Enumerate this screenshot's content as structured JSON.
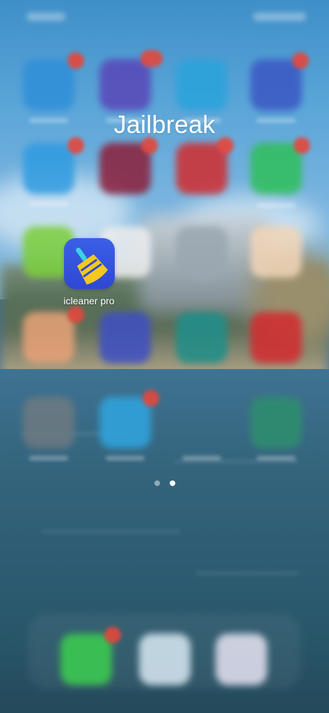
{
  "folder": {
    "title": "Jailbreak"
  },
  "app": {
    "label": "icleaner pro",
    "icon": "broom-icon",
    "icon_color": "#3553de",
    "glyph_color": "#f5c81e"
  },
  "pagination": {
    "page_count": 2,
    "current_page": 2
  }
}
